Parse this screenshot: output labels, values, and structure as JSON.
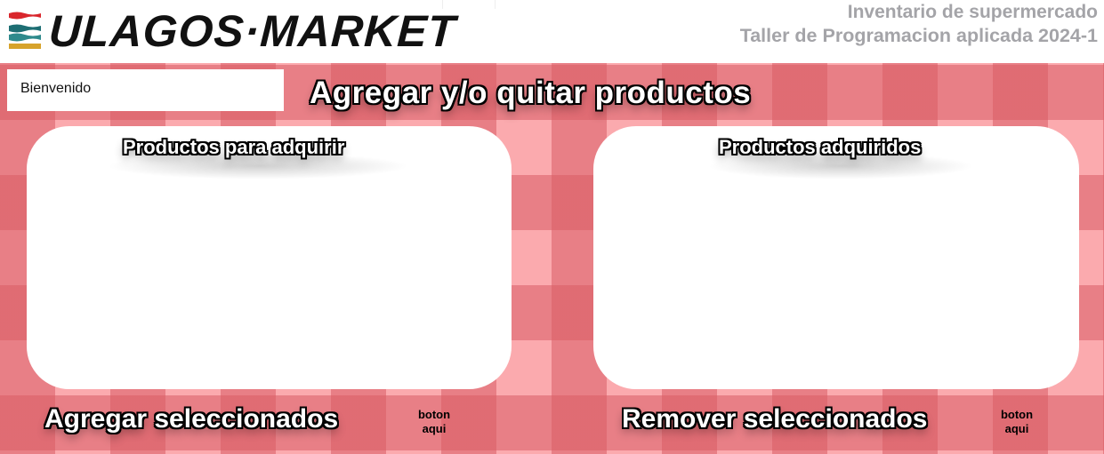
{
  "header": {
    "logo_text": "ULAGOS·MARKET",
    "subtitle_line1": "Inventario de supermercado",
    "subtitle_line2": "Taller de Programacion aplicada 2024-1"
  },
  "welcome": {
    "text": "Bienvenido"
  },
  "main": {
    "title": "Agregar y/o quitar productos"
  },
  "panels": {
    "available": {
      "title": "Productos para adquirir"
    },
    "acquired": {
      "title": "Productos adquiridos"
    }
  },
  "actions": {
    "add": {
      "label": "Agregar seleccionados",
      "button_line1": "boton",
      "button_line2": "aqui"
    },
    "remove": {
      "label": "Remover seleccionados",
      "button_line1": "boton",
      "button_line2": "aqui"
    }
  },
  "colors": {
    "checker_light": "#fba3a8",
    "checker_dark": "#e8737c",
    "logo_red": "#d9262c",
    "logo_teal": "#1d6e73",
    "logo_gold": "#d7a32b",
    "subtitle_gray": "#a4a4a8"
  }
}
